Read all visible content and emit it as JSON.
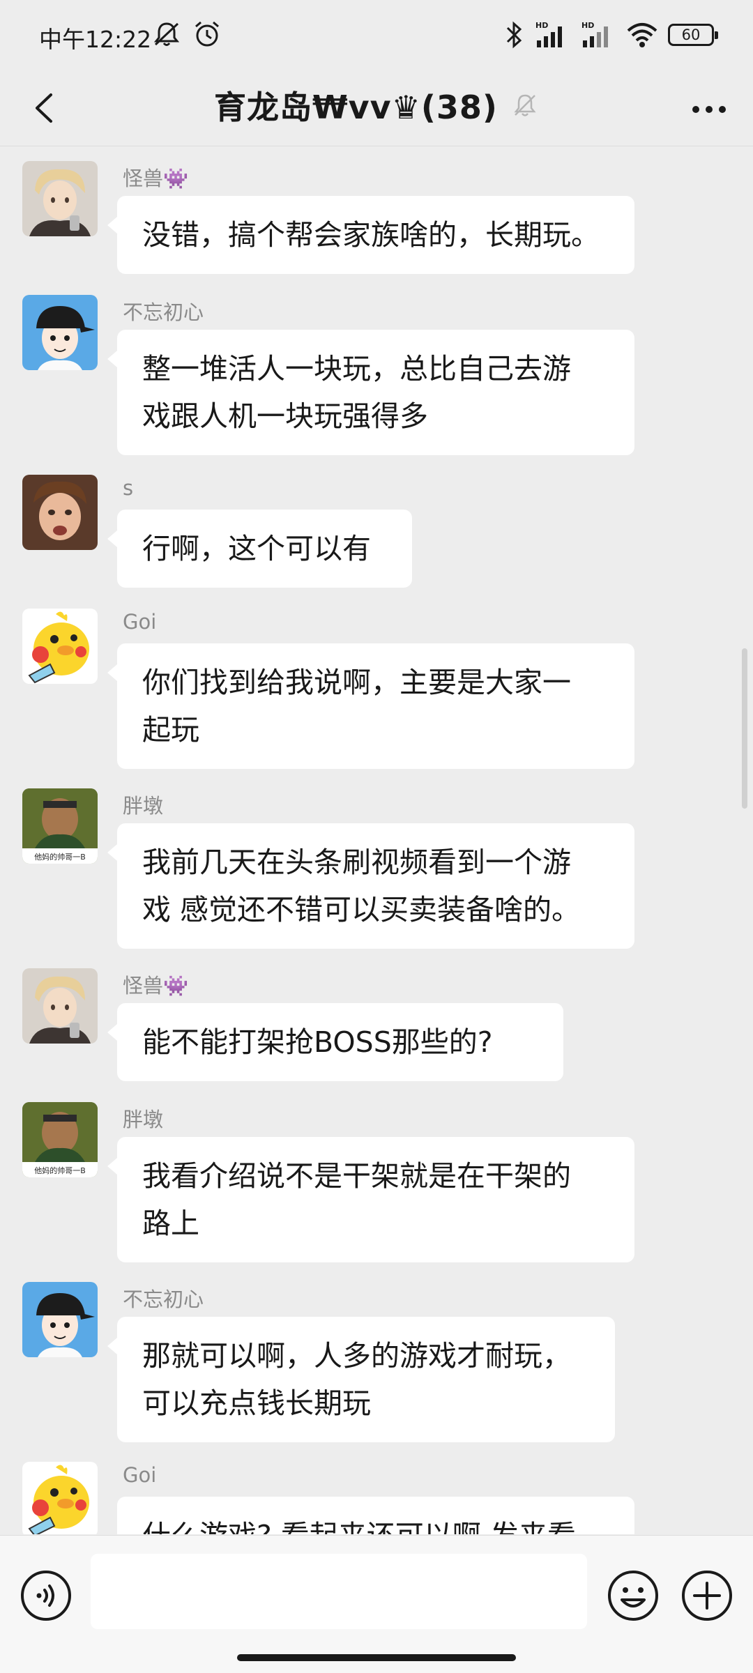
{
  "status_bar": {
    "time": "中午12:22",
    "battery": "60"
  },
  "header": {
    "title": "育龙岛₩vv♛(38)"
  },
  "messages": [
    {
      "sender": "怪兽👾",
      "text": "没错，搞个帮会家族啥的，长期玩。",
      "avatar": "blonde-boy-avatar"
    },
    {
      "sender": "不忘初心",
      "text": "整一堆活人一块玩，总比自己去游\n戏跟人机一块玩强得多",
      "avatar": "cap-boy-avatar"
    },
    {
      "sender": "s",
      "text": "行啊，这个可以有",
      "avatar": "kid-face-avatar"
    },
    {
      "sender": "Goi",
      "text": "你们找到给我说啊，主要是大家一\n起玩",
      "avatar": "yellow-duck-avatar"
    },
    {
      "sender": "胖墩",
      "text": "我前几天在头条刷视频看到一个游\n戏 感觉还不错可以买卖装备啥的。",
      "avatar": "meme-man-avatar"
    },
    {
      "sender": "怪兽👾",
      "text": "能不能打架抢BOSS那些的?",
      "avatar": "blonde-boy-avatar"
    },
    {
      "sender": "胖墩",
      "text": "我看介绍说不是干架就是在干架的\n路上",
      "avatar": "meme-man-avatar"
    },
    {
      "sender": "不忘初心",
      "text": "那就可以啊，人多的游戏才耐玩，\n可以充点钱长期玩",
      "avatar": "cap-boy-avatar"
    },
    {
      "sender": "Goi",
      "text": "什么游戏? 看起来还可以啊 发来看",
      "avatar": "yellow-duck-avatar"
    }
  ],
  "avatar_captions": {
    "meme": "他妈的帅哥一B"
  },
  "input_bar": {
    "placeholder": ""
  },
  "colors": {
    "background": "#ededed",
    "bubble": "#ffffff",
    "sender_name": "#8a8a8a"
  }
}
